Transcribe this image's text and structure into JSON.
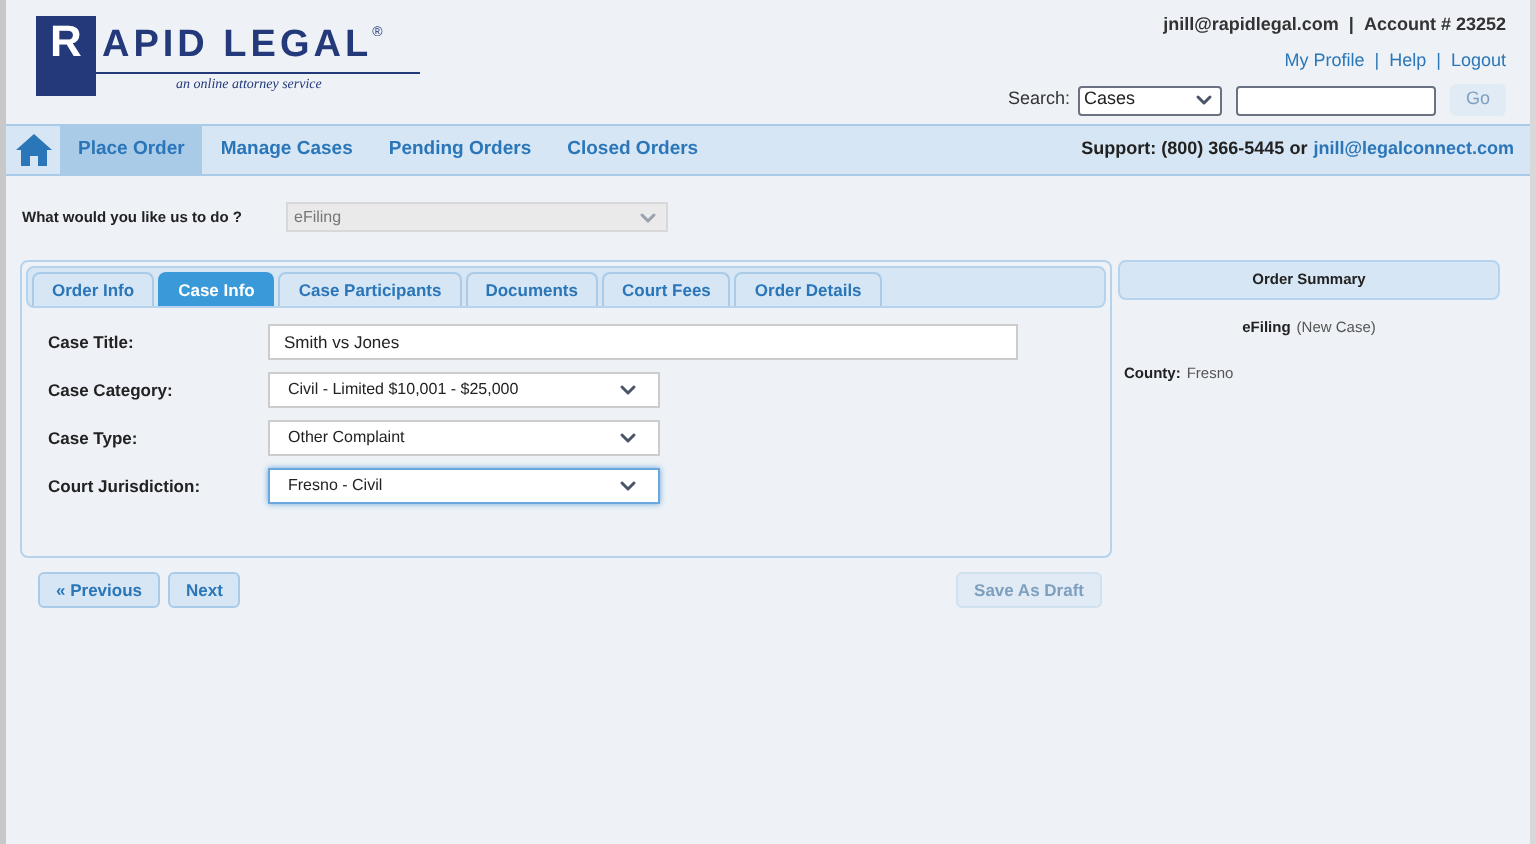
{
  "logo": {
    "initial": "R",
    "name": "APID LEGAL",
    "mark": "®",
    "tagline": "an online attorney service"
  },
  "account": {
    "email": "jnill@rapidlegal.com",
    "separator": "|",
    "account": "Account # 23252"
  },
  "links": [
    {
      "label": "My Profile"
    },
    {
      "label": "Help"
    },
    {
      "label": "Logout"
    }
  ],
  "link_separator": "|",
  "search": {
    "label": "Search:",
    "scope": "Cases",
    "button": "Go",
    "button_disabled": true
  },
  "nav": [
    {
      "label": "Place Order",
      "selected": true
    },
    {
      "label": "Manage Cases",
      "selected": false
    },
    {
      "label": "Pending Orders",
      "selected": false
    },
    {
      "label": "Closed Orders",
      "selected": false
    }
  ],
  "support": {
    "text": "Support: (800) 366-5445 or",
    "email": "jnill@legalconnect.com"
  },
  "question": {
    "label": "What would you like us to do ?",
    "value": "eFiling",
    "disabled": true
  },
  "tabs": [
    {
      "label": "Order Info",
      "selected": false
    },
    {
      "label": "Case Info",
      "selected": true
    },
    {
      "label": "Case Participants",
      "selected": false
    },
    {
      "label": "Documents",
      "selected": false
    },
    {
      "label": "Court Fees",
      "selected": false
    },
    {
      "label": "Order Details",
      "selected": false
    }
  ],
  "fields": [
    {
      "label": "Case Title:",
      "kind": "text",
      "value": "Smith vs Jones",
      "focused": false
    },
    {
      "label": "Case Category:",
      "kind": "select",
      "value": "Civil - Limited $10,001 - $25,000",
      "focused": false
    },
    {
      "label": "Case Type:",
      "kind": "select",
      "value": "Other Complaint",
      "focused": false
    },
    {
      "label": "Court Jurisdiction:",
      "kind": "select",
      "value": "Fresno - Civil",
      "focused": true
    }
  ],
  "summary": {
    "title": "Order Summary",
    "service": "eFiling",
    "service_note": "(New Case)",
    "county_label": "County:",
    "county": "Fresno"
  },
  "buttons": [
    {
      "label": "« Previous",
      "disabled": false
    },
    {
      "label": "Next",
      "disabled": false
    }
  ],
  "draft_button": {
    "label": "Save As Draft",
    "disabled": true
  }
}
